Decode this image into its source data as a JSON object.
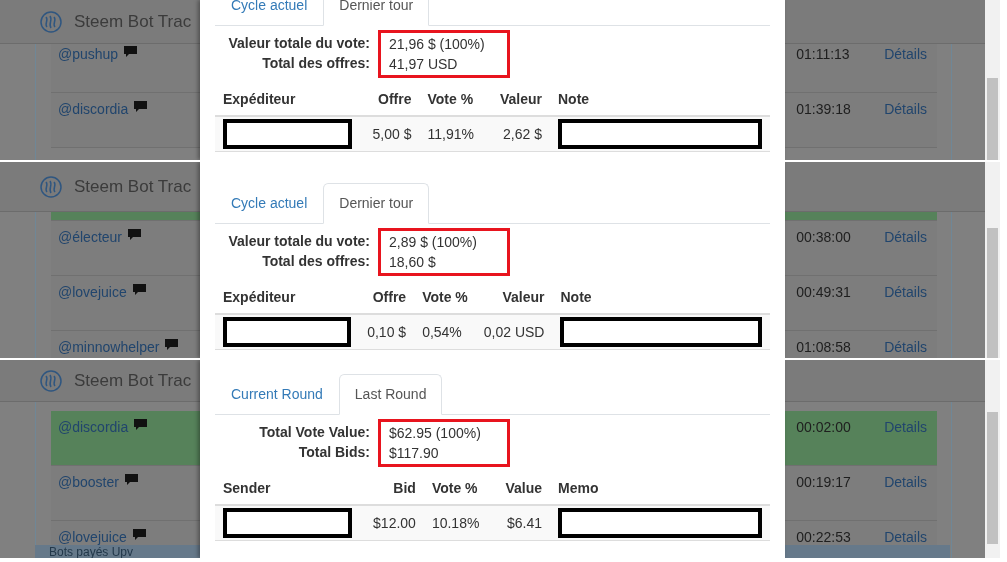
{
  "panels": [
    {
      "navbar": {
        "title": "Steem Bot Trac"
      },
      "page_rows": [
        {
          "user": "@pushup",
          "time": "01:11:13",
          "link": "Détails",
          "highlighted": false
        },
        {
          "user": "@discordia",
          "time": "01:39:18",
          "link": "Détails",
          "highlighted": false
        }
      ],
      "modal": {
        "tabs": [
          {
            "label": "Cycle actuel",
            "selected": false
          },
          {
            "label": "Dernier tour",
            "selected": true
          }
        ],
        "summary": [
          {
            "label": "Valeur totale du vote:",
            "value": "21,96 $ (100%)"
          },
          {
            "label": "Total des offres:",
            "value": "41,97 USD"
          }
        ],
        "summary_highlighted": true,
        "columns": [
          "Expéditeur",
          "Offre",
          "Vote %",
          "Valeur",
          "Note"
        ],
        "rows": [
          {
            "cells": [
              {
                "kind": "redacted"
              },
              {
                "kind": "text",
                "text": "5,00 $"
              },
              {
                "kind": "text",
                "text": "11,91%"
              },
              {
                "kind": "text",
                "text": "2,62 $"
              },
              {
                "kind": "redacted"
              }
            ]
          }
        ]
      }
    },
    {
      "navbar": {
        "title": "Steem Bot Trac"
      },
      "page_rows": [
        {
          "highlighted": true
        },
        {
          "user": "@électeur",
          "time": "00:38:00",
          "link": "Détails",
          "highlighted": false
        },
        {
          "user": "@lovejuice",
          "time": "00:49:31",
          "link": "Détails",
          "highlighted": false
        },
        {
          "user": "@minnowhelper",
          "time": "01:08:58",
          "link": "Détails",
          "highlighted": false
        }
      ],
      "modal": {
        "tabs": [
          {
            "label": "Cycle actuel",
            "selected": false
          },
          {
            "label": "Dernier tour",
            "selected": true
          }
        ],
        "summary": [
          {
            "label": "Valeur totale du vote:",
            "value": "2,89 $ (100%)"
          },
          {
            "label": "Total des offres:",
            "value": "18,60 $"
          }
        ],
        "summary_highlighted": true,
        "columns": [
          "Expéditeur",
          "Offre",
          "Vote %",
          "Valeur",
          "Note"
        ],
        "rows": [
          {
            "cells": [
              {
                "kind": "redacted"
              },
              {
                "kind": "text",
                "text": "0,10 $"
              },
              {
                "kind": "text",
                "text": "0,54%"
              },
              {
                "kind": "text",
                "text": "0,02 USD"
              },
              {
                "kind": "redacted"
              }
            ]
          }
        ]
      }
    },
    {
      "navbar": {
        "title": "Steem Bot Trac"
      },
      "page_rows": [
        {
          "user": "@discordia",
          "time": "00:02:00",
          "link": "Details",
          "highlighted": true
        },
        {
          "user": "@booster",
          "time": "00:19:17",
          "link": "Details",
          "highlighted": false
        },
        {
          "user": "@lovejuice",
          "time": "00:22:53",
          "link": "Details",
          "highlighted": false
        }
      ],
      "page_heading": "Bots payés Upv",
      "modal": {
        "tabs": [
          {
            "label": "Current Round",
            "selected": false
          },
          {
            "label": "Last Round",
            "selected": true
          }
        ],
        "summary": [
          {
            "label": "Total Vote Value:",
            "value": "$62.95 (100%)"
          },
          {
            "label": "Total Bids:",
            "value": "$117.90"
          }
        ],
        "summary_highlighted": true,
        "columns": [
          "Sender",
          "Bid",
          "Vote %",
          "Value",
          "Memo"
        ],
        "rows": [
          {
            "cells": [
              {
                "kind": "redacted"
              },
              {
                "kind": "text",
                "text": "$12.00"
              },
              {
                "kind": "text",
                "text": "10.18%"
              },
              {
                "kind": "text",
                "text": "$6.41"
              },
              {
                "kind": "redacted"
              }
            ]
          }
        ]
      }
    }
  ]
}
